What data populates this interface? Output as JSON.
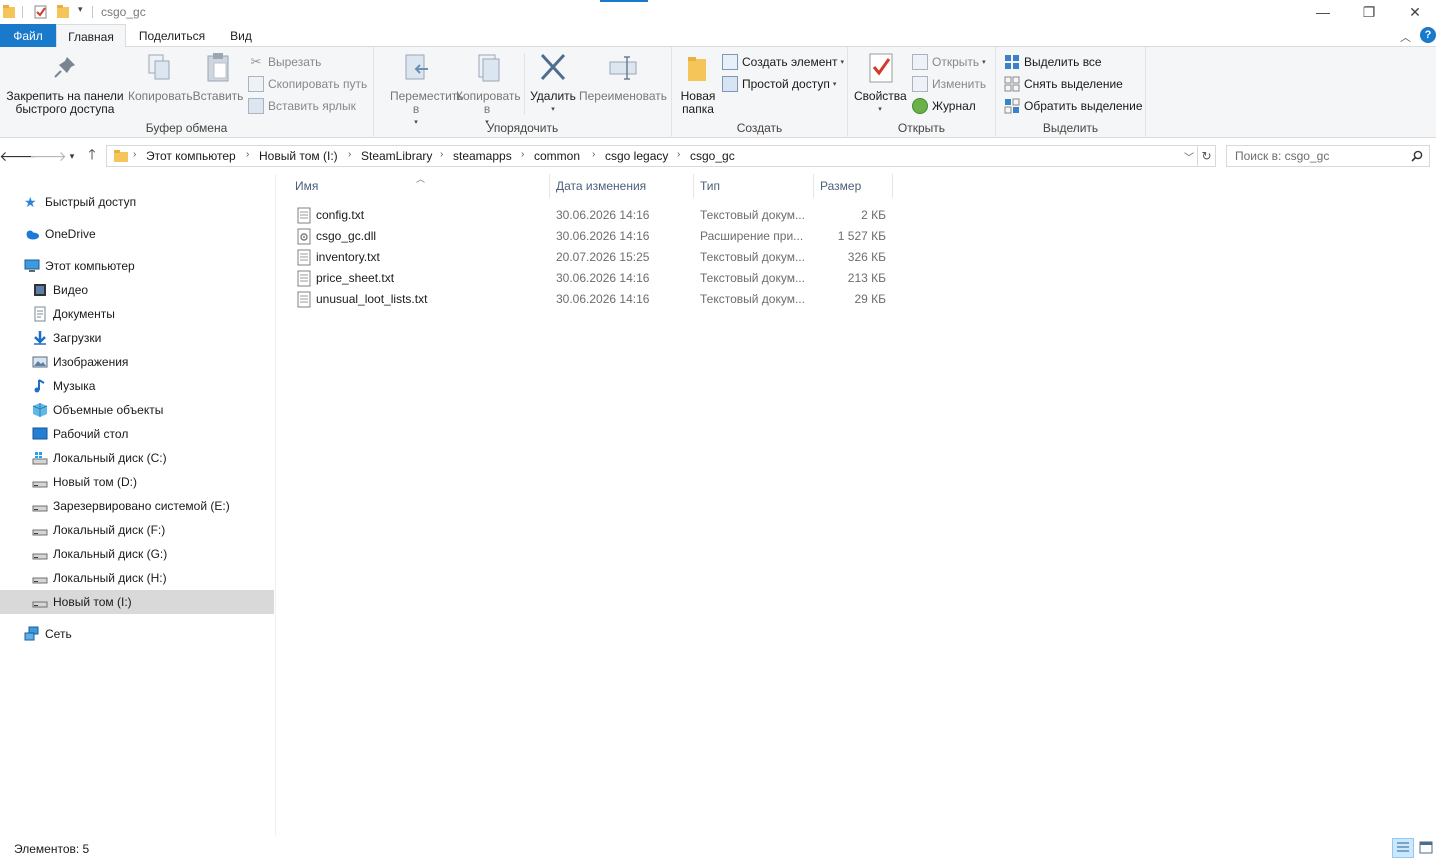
{
  "window": {
    "title": "csgo_gc",
    "minimize_glyph": "—",
    "restore_glyph": "❐",
    "close_glyph": "✕"
  },
  "ribbon_tabs": {
    "file": "Файл",
    "home": "Главная",
    "share": "Поделиться",
    "view": "Вид"
  },
  "ribbon": {
    "clipboard": {
      "label": "Буфер обмена",
      "pin": "Закрепить на панели быстрого доступа",
      "copy": "Копировать",
      "paste": "Вставить",
      "cut": "Вырезать",
      "copy_path": "Скопировать путь",
      "paste_shortcut": "Вставить ярлык"
    },
    "organize": {
      "label": "Упорядочить",
      "move_to": "Переместить в",
      "copy_to": "Копировать в",
      "delete": "Удалить",
      "rename": "Переименовать"
    },
    "new": {
      "label": "Создать",
      "new_folder": "Новая папка",
      "new_item": "Создать элемент",
      "easy_access": "Простой доступ"
    },
    "open": {
      "label": "Открыть",
      "properties": "Свойства",
      "open": "Открыть",
      "edit": "Изменить",
      "history": "Журнал"
    },
    "select": {
      "label": "Выделить",
      "select_all": "Выделить все",
      "select_none": "Снять выделение",
      "invert": "Обратить выделение"
    }
  },
  "address": {
    "crumbs": [
      "Этот компьютер",
      "Новый том (I:)",
      "SteamLibrary",
      "steamapps",
      "common",
      "csgo legacy",
      "csgo_gc"
    ],
    "search_placeholder": "Поиск в: csgo_gc"
  },
  "nav": {
    "quick_access": "Быстрый доступ",
    "onedrive": "OneDrive",
    "this_pc": "Этот компьютер",
    "items": [
      {
        "label": "Видео",
        "icon": "video-folder-icon"
      },
      {
        "label": "Документы",
        "icon": "documents-folder-icon"
      },
      {
        "label": "Загрузки",
        "icon": "downloads-folder-icon"
      },
      {
        "label": "Изображения",
        "icon": "pictures-folder-icon"
      },
      {
        "label": "Музыка",
        "icon": "music-folder-icon"
      },
      {
        "label": "Объемные объекты",
        "icon": "3d-objects-folder-icon"
      },
      {
        "label": "Рабочий стол",
        "icon": "desktop-folder-icon"
      },
      {
        "label": "Локальный диск (C:)",
        "icon": "system-drive-icon"
      },
      {
        "label": "Новый том (D:)",
        "icon": "drive-icon"
      },
      {
        "label": "Зарезервировано системой (E:)",
        "icon": "drive-icon"
      },
      {
        "label": "Локальный диск (F:)",
        "icon": "drive-icon"
      },
      {
        "label": "Локальный диск (G:)",
        "icon": "drive-icon"
      },
      {
        "label": "Локальный диск (H:)",
        "icon": "drive-icon"
      },
      {
        "label": "Новый том (I:)",
        "icon": "drive-icon",
        "selected": true
      }
    ],
    "network": "Сеть"
  },
  "columns": {
    "name": "Имя",
    "date": "Дата изменения",
    "type": "Тип",
    "size": "Размер"
  },
  "files": [
    {
      "name": "config.txt",
      "date": "30.06.2026 14:16",
      "type": "Текстовый докум...",
      "size": "2 КБ",
      "icon": "text-file-icon"
    },
    {
      "name": "csgo_gc.dll",
      "date": "30.06.2026 14:16",
      "type": "Расширение при...",
      "size": "1 527 КБ",
      "icon": "dll-file-icon"
    },
    {
      "name": "inventory.txt",
      "date": "20.07.2026 15:25",
      "type": "Текстовый докум...",
      "size": "326 КБ",
      "icon": "text-file-icon"
    },
    {
      "name": "price_sheet.txt",
      "date": "30.06.2026 14:16",
      "type": "Текстовый докум...",
      "size": "213 КБ",
      "icon": "text-file-icon"
    },
    {
      "name": "unusual_loot_lists.txt",
      "date": "30.06.2026 14:16",
      "type": "Текстовый докум...",
      "size": "29 КБ",
      "icon": "text-file-icon"
    }
  ],
  "status": {
    "items_count": "Элементов: 5"
  },
  "colors": {
    "accent": "#1979ca",
    "ribbon_bg": "#f5f6f7",
    "selected_nav": "#d9d9d9",
    "header_text": "#4c607a"
  }
}
